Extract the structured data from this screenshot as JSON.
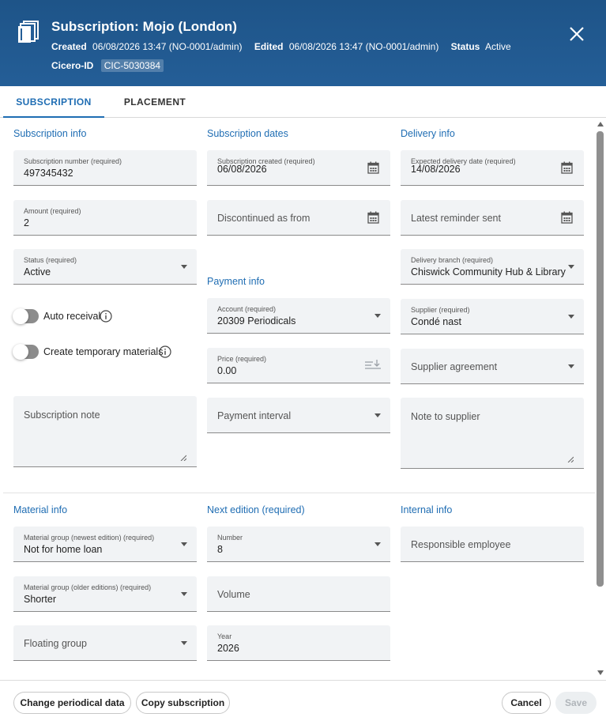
{
  "header": {
    "title": "Subscription: Mojo (London)",
    "created_label": "Created",
    "created_value": "06/08/2026 13:47 (NO-0001/admin)",
    "edited_label": "Edited",
    "edited_value": "06/08/2026 13:47 (NO-0001/admin)",
    "status_label": "Status",
    "status_value": "Active",
    "cicero_label": "Cicero-ID",
    "cicero_value": "CIC-5030384"
  },
  "tabs": [
    {
      "label": "SUBSCRIPTION",
      "active": true
    },
    {
      "label": "PLACEMENT",
      "active": false
    }
  ],
  "subscription_info": {
    "heading": "Subscription info",
    "number": {
      "label": "Subscription number (required)",
      "value": "497345432"
    },
    "amount": {
      "label": "Amount (required)",
      "value": "2"
    },
    "status": {
      "label": "Status (required)",
      "value": "Active"
    },
    "auto_receival": {
      "label": "Auto receival",
      "on": false
    },
    "create_temp": {
      "label": "Create temporary materials",
      "on": false
    },
    "note": {
      "placeholder": "Subscription note"
    }
  },
  "subscription_dates": {
    "heading": "Subscription dates",
    "created": {
      "label": "Subscription created (required)",
      "value": "06/08/2026"
    },
    "discontinued": {
      "placeholder": "Discontinued as from"
    }
  },
  "payment_info": {
    "heading": "Payment info",
    "account": {
      "label": "Account (required)",
      "value": "20309 Periodicals"
    },
    "price": {
      "label": "Price (required)",
      "value": "0.00"
    },
    "interval": {
      "placeholder": "Payment interval"
    }
  },
  "delivery_info": {
    "heading": "Delivery info",
    "expected": {
      "label": "Expected delivery date (required)",
      "value": "14/08/2026"
    },
    "reminder": {
      "placeholder": "Latest reminder sent"
    },
    "branch": {
      "label": "Delivery branch (required)",
      "value": "Chiswick Community Hub & Library"
    },
    "supplier": {
      "label": "Supplier (required)",
      "value": "Condé nast"
    },
    "agreement": {
      "placeholder": "Supplier agreement"
    },
    "note": {
      "placeholder": "Note to supplier"
    }
  },
  "material_info": {
    "heading": "Material info",
    "newest": {
      "label": "Material group (newest edition) (required)",
      "value": "Not for home loan"
    },
    "older": {
      "label": "Material group (older editions) (required)",
      "value": "Shorter"
    },
    "floating": {
      "placeholder": "Floating group"
    }
  },
  "next_edition": {
    "heading": "Next edition (required)",
    "number": {
      "label": "Number",
      "value": "8"
    },
    "volume": {
      "placeholder": "Volume"
    },
    "year": {
      "label": "Year",
      "value": "2026"
    }
  },
  "internal_info": {
    "heading": "Internal info",
    "employee": {
      "placeholder": "Responsible employee"
    }
  },
  "footer": {
    "change_periodical": "Change periodical data",
    "copy_subscription": "Copy subscription",
    "cancel": "Cancel",
    "save": "Save"
  },
  "colors": {
    "header_bg": "#245e97",
    "accent": "#1f6db3",
    "field_bg": "#f1f3f5"
  },
  "icons": {
    "header": "stacked-documents-icon",
    "close": "close-icon",
    "calendar": "calendar-icon",
    "dropdown": "caret-down-icon",
    "info": "info-icon",
    "price": "sort-descending-icon"
  }
}
